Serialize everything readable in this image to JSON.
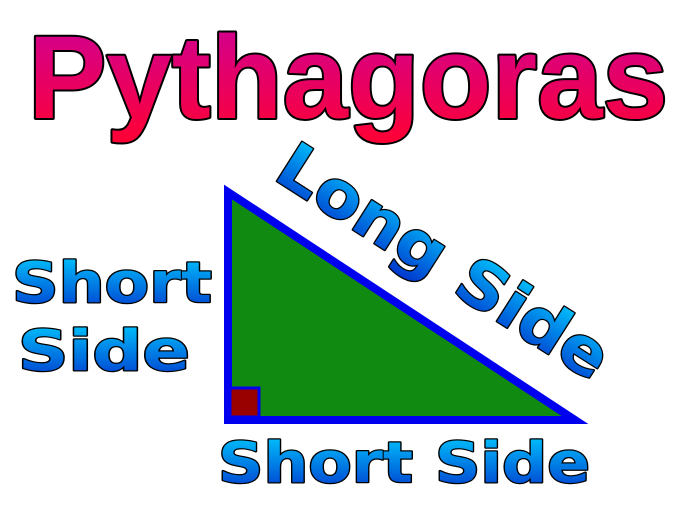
{
  "title": "Pythagoras",
  "labels": {
    "hypotenuse": "Long Side",
    "vertical_leg_line1": "Short",
    "vertical_leg_line2": "Side",
    "horizontal_leg": "Short Side"
  },
  "colors": {
    "title_gradient_top": "#cc0099",
    "title_gradient_bottom": "#ff0033",
    "label_gradient_top": "#00ccff",
    "label_gradient_bottom": "#0033cc",
    "triangle_fill": "#108a10",
    "triangle_border": "#0000ee",
    "right_angle_marker": "#990000",
    "outline": "#000000"
  }
}
